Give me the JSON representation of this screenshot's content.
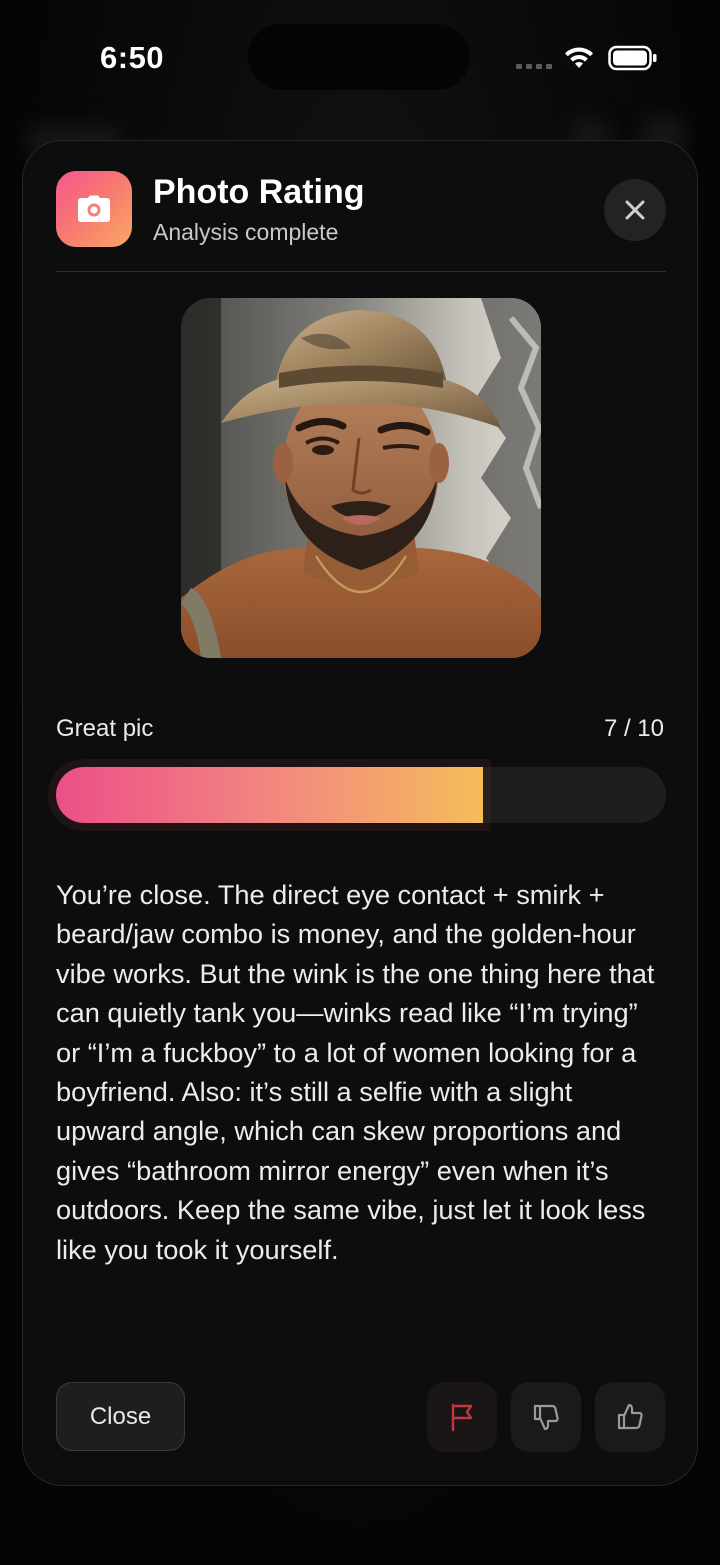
{
  "status_bar": {
    "time": "6:50"
  },
  "modal": {
    "title": "Photo Rating",
    "subtitle": "Analysis complete",
    "header_icon": "camera-icon",
    "close_icon": "close-icon",
    "photo_icon": "person-photo",
    "rating": {
      "label": "Great pic",
      "score_text": "7 / 10",
      "score": 7,
      "max": 10,
      "fill_percent": 70
    },
    "feedback": "You’re close. The direct eye contact + smirk + beard/jaw combo is money, and the golden-hour vibe works. But the wink is the one thing here that can quietly tank you—winks read like “I’m trying” or “I’m a fuckboy” to a lot of women looking for a boyfriend. Also: it’s still a selfie with a slight upward angle, which can skew proportions and gives “bathroom mirror energy” even when it’s outdoors. Keep the same vibe, just let it look less like you took it yourself.",
    "actions": {
      "close_label": "Close",
      "flag_icon": "flag-icon",
      "thumbs_down_icon": "thumbs-down-icon",
      "thumbs_up_icon": "thumbs-up-icon"
    }
  },
  "colors": {
    "accent_start": "#ec4f88",
    "accent_end": "#f5bd5a",
    "modal_bg": "#0d0d0d",
    "flag_color": "#c0383e"
  }
}
